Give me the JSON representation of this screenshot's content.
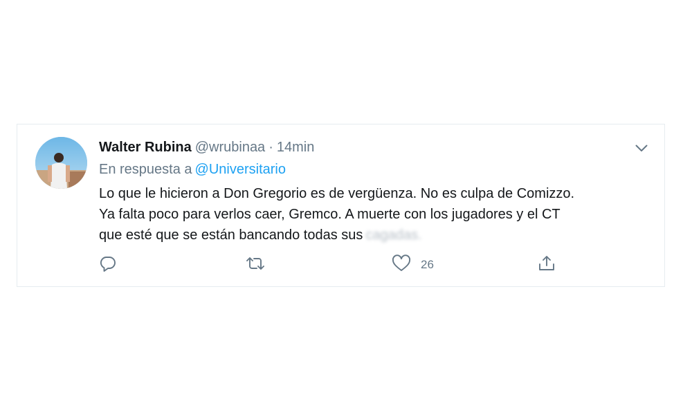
{
  "tweet": {
    "author_name": "Walter Rubina",
    "handle": "@wrubinaa",
    "separator": "·",
    "time": "14min",
    "reply_prefix": "En respuesta a",
    "reply_to": "@Universitario",
    "text_line1": "Lo que le hicieron a Don Gregorio es de vergüenza. No es culpa de Comizzo.",
    "text_line2": "Ya falta poco para verlos caer, Gremco. A muerte con los jugadores y el CT",
    "text_line3": "que esté que se están bancando todas sus",
    "text_blurred": "cagadas.",
    "actions": {
      "reply_icon": "reply-icon",
      "retweet_icon": "retweet-icon",
      "like_icon": "heart-icon",
      "like_count": "26",
      "share_icon": "share-icon"
    },
    "menu_icon": "chevron-down-icon"
  },
  "colors": {
    "text": "#14171a",
    "secondary": "#657786",
    "link": "#1da1f2",
    "border": "#e6ecf0"
  }
}
